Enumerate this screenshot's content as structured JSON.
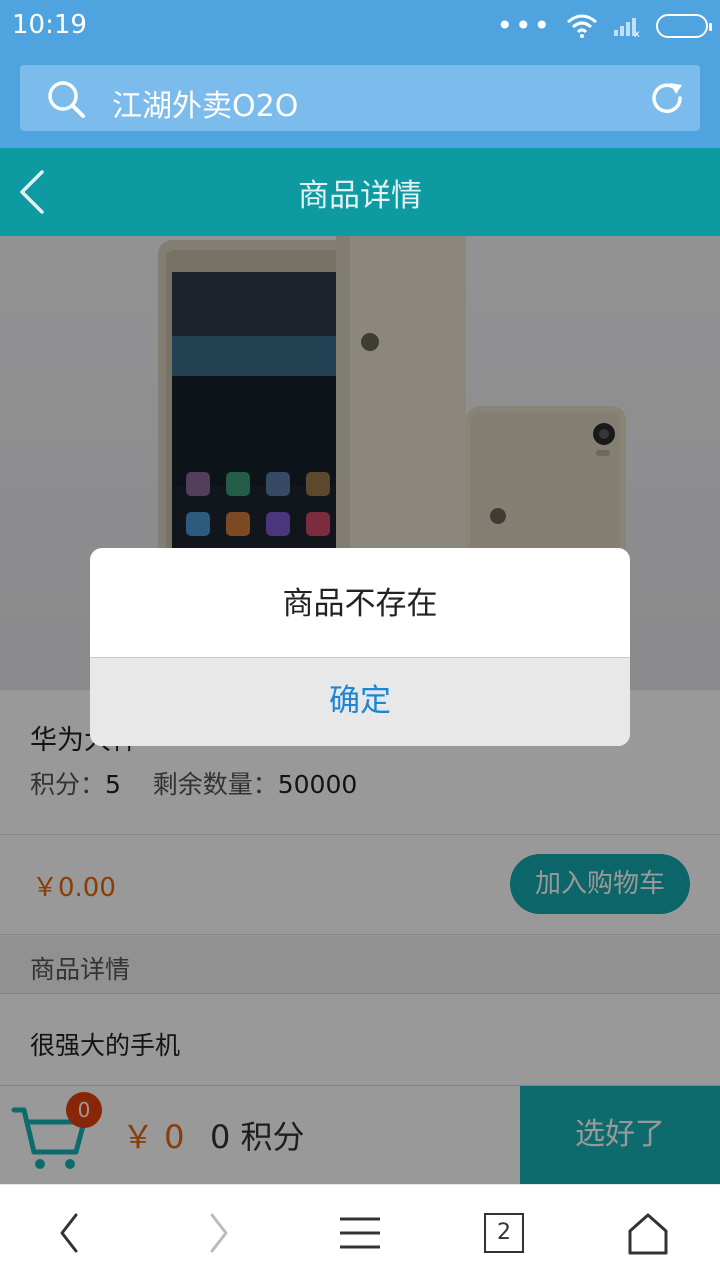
{
  "status": {
    "time": "10:19",
    "dots": "•••"
  },
  "browser": {
    "url_text": "江湖外卖O2O"
  },
  "nav": {
    "title": "商品详情"
  },
  "product": {
    "name": "华为大神",
    "points_label": "积分：",
    "points_value": "5",
    "stock_label": "剩余数量：",
    "stock_value": "50000",
    "price": "￥0.00",
    "add_to_cart_label": "加入购物车"
  },
  "details": {
    "header": "商品详情",
    "body": "很强大的手机"
  },
  "cart": {
    "badge_count": "0",
    "yen_amount": "￥ 0",
    "points_text": "0 积分",
    "checkout_label": "选好了"
  },
  "dialog": {
    "message": "商品不存在",
    "confirm_label": "确定"
  },
  "browser_nav": {
    "tab_count": "2"
  },
  "colors": {
    "status_bar": "#4fa3de",
    "nav_bar": "#0d9aa0",
    "accent": "#15a8ad",
    "price": "#e5670e",
    "dialog_button": "#1a87d6"
  }
}
